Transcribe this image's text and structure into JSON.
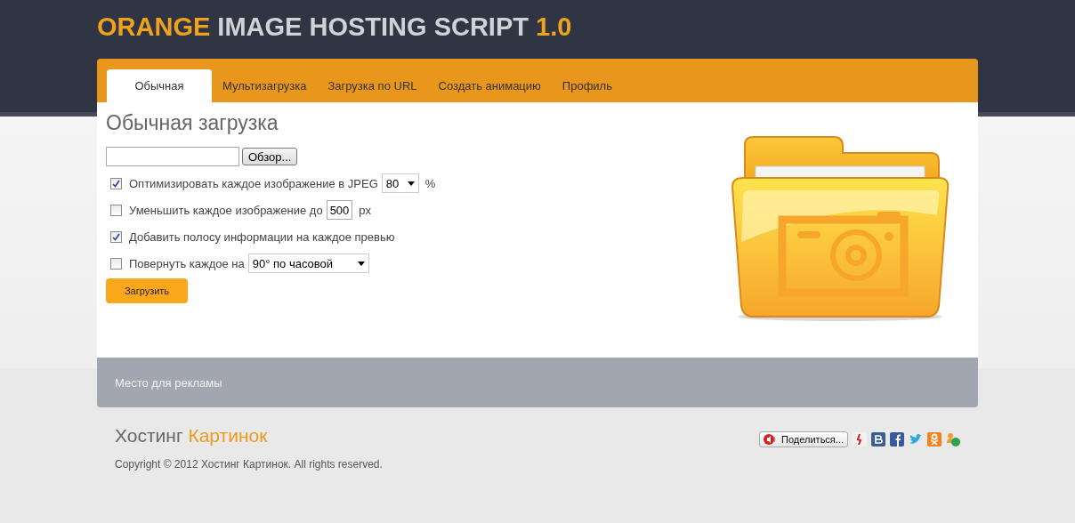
{
  "site_title": [
    {
      "text": "ORANGE",
      "kind": "accent"
    },
    {
      "text": "IMAGE HOSTING SCRIPT",
      "kind": "plain"
    },
    {
      "text": "1.0",
      "kind": "accent"
    }
  ],
  "tabs": [
    {
      "label": "Обычная",
      "selected": true
    },
    {
      "label": "Мультизагрузка",
      "selected": false
    },
    {
      "label": "Загрузка по URL",
      "selected": false
    },
    {
      "label": "Создать анимацию",
      "selected": false
    },
    {
      "label": "Профиль",
      "selected": false
    }
  ],
  "heading": "Обычная загрузка",
  "browse_button": "Обзор...",
  "options": [
    {
      "kind": "select",
      "checked": true,
      "label": "Оптимизировать каждое изображение в JPEG",
      "value": "80",
      "suffix": "%"
    },
    {
      "kind": "input",
      "checked": false,
      "label": "Уменьшить каждое изображение до",
      "value": "500",
      "suffix": "px"
    },
    {
      "kind": "plain",
      "checked": true,
      "label": "Добавить полосу информации на каждое превью"
    },
    {
      "kind": "select",
      "checked": false,
      "label": "Повернуть каждое на",
      "value": "90° по часовой"
    }
  ],
  "submit_button": "Загрузить",
  "ad_text": "Место для рекламы",
  "footer": {
    "brand": [
      {
        "text": "Хостинг",
        "kind": "plain"
      },
      {
        "text": "Картинок",
        "kind": "accent"
      }
    ],
    "copyright": "Copyright © 2012 Хостинг Картинок. All rights reserved.",
    "share_button": "Поделиться..."
  }
}
